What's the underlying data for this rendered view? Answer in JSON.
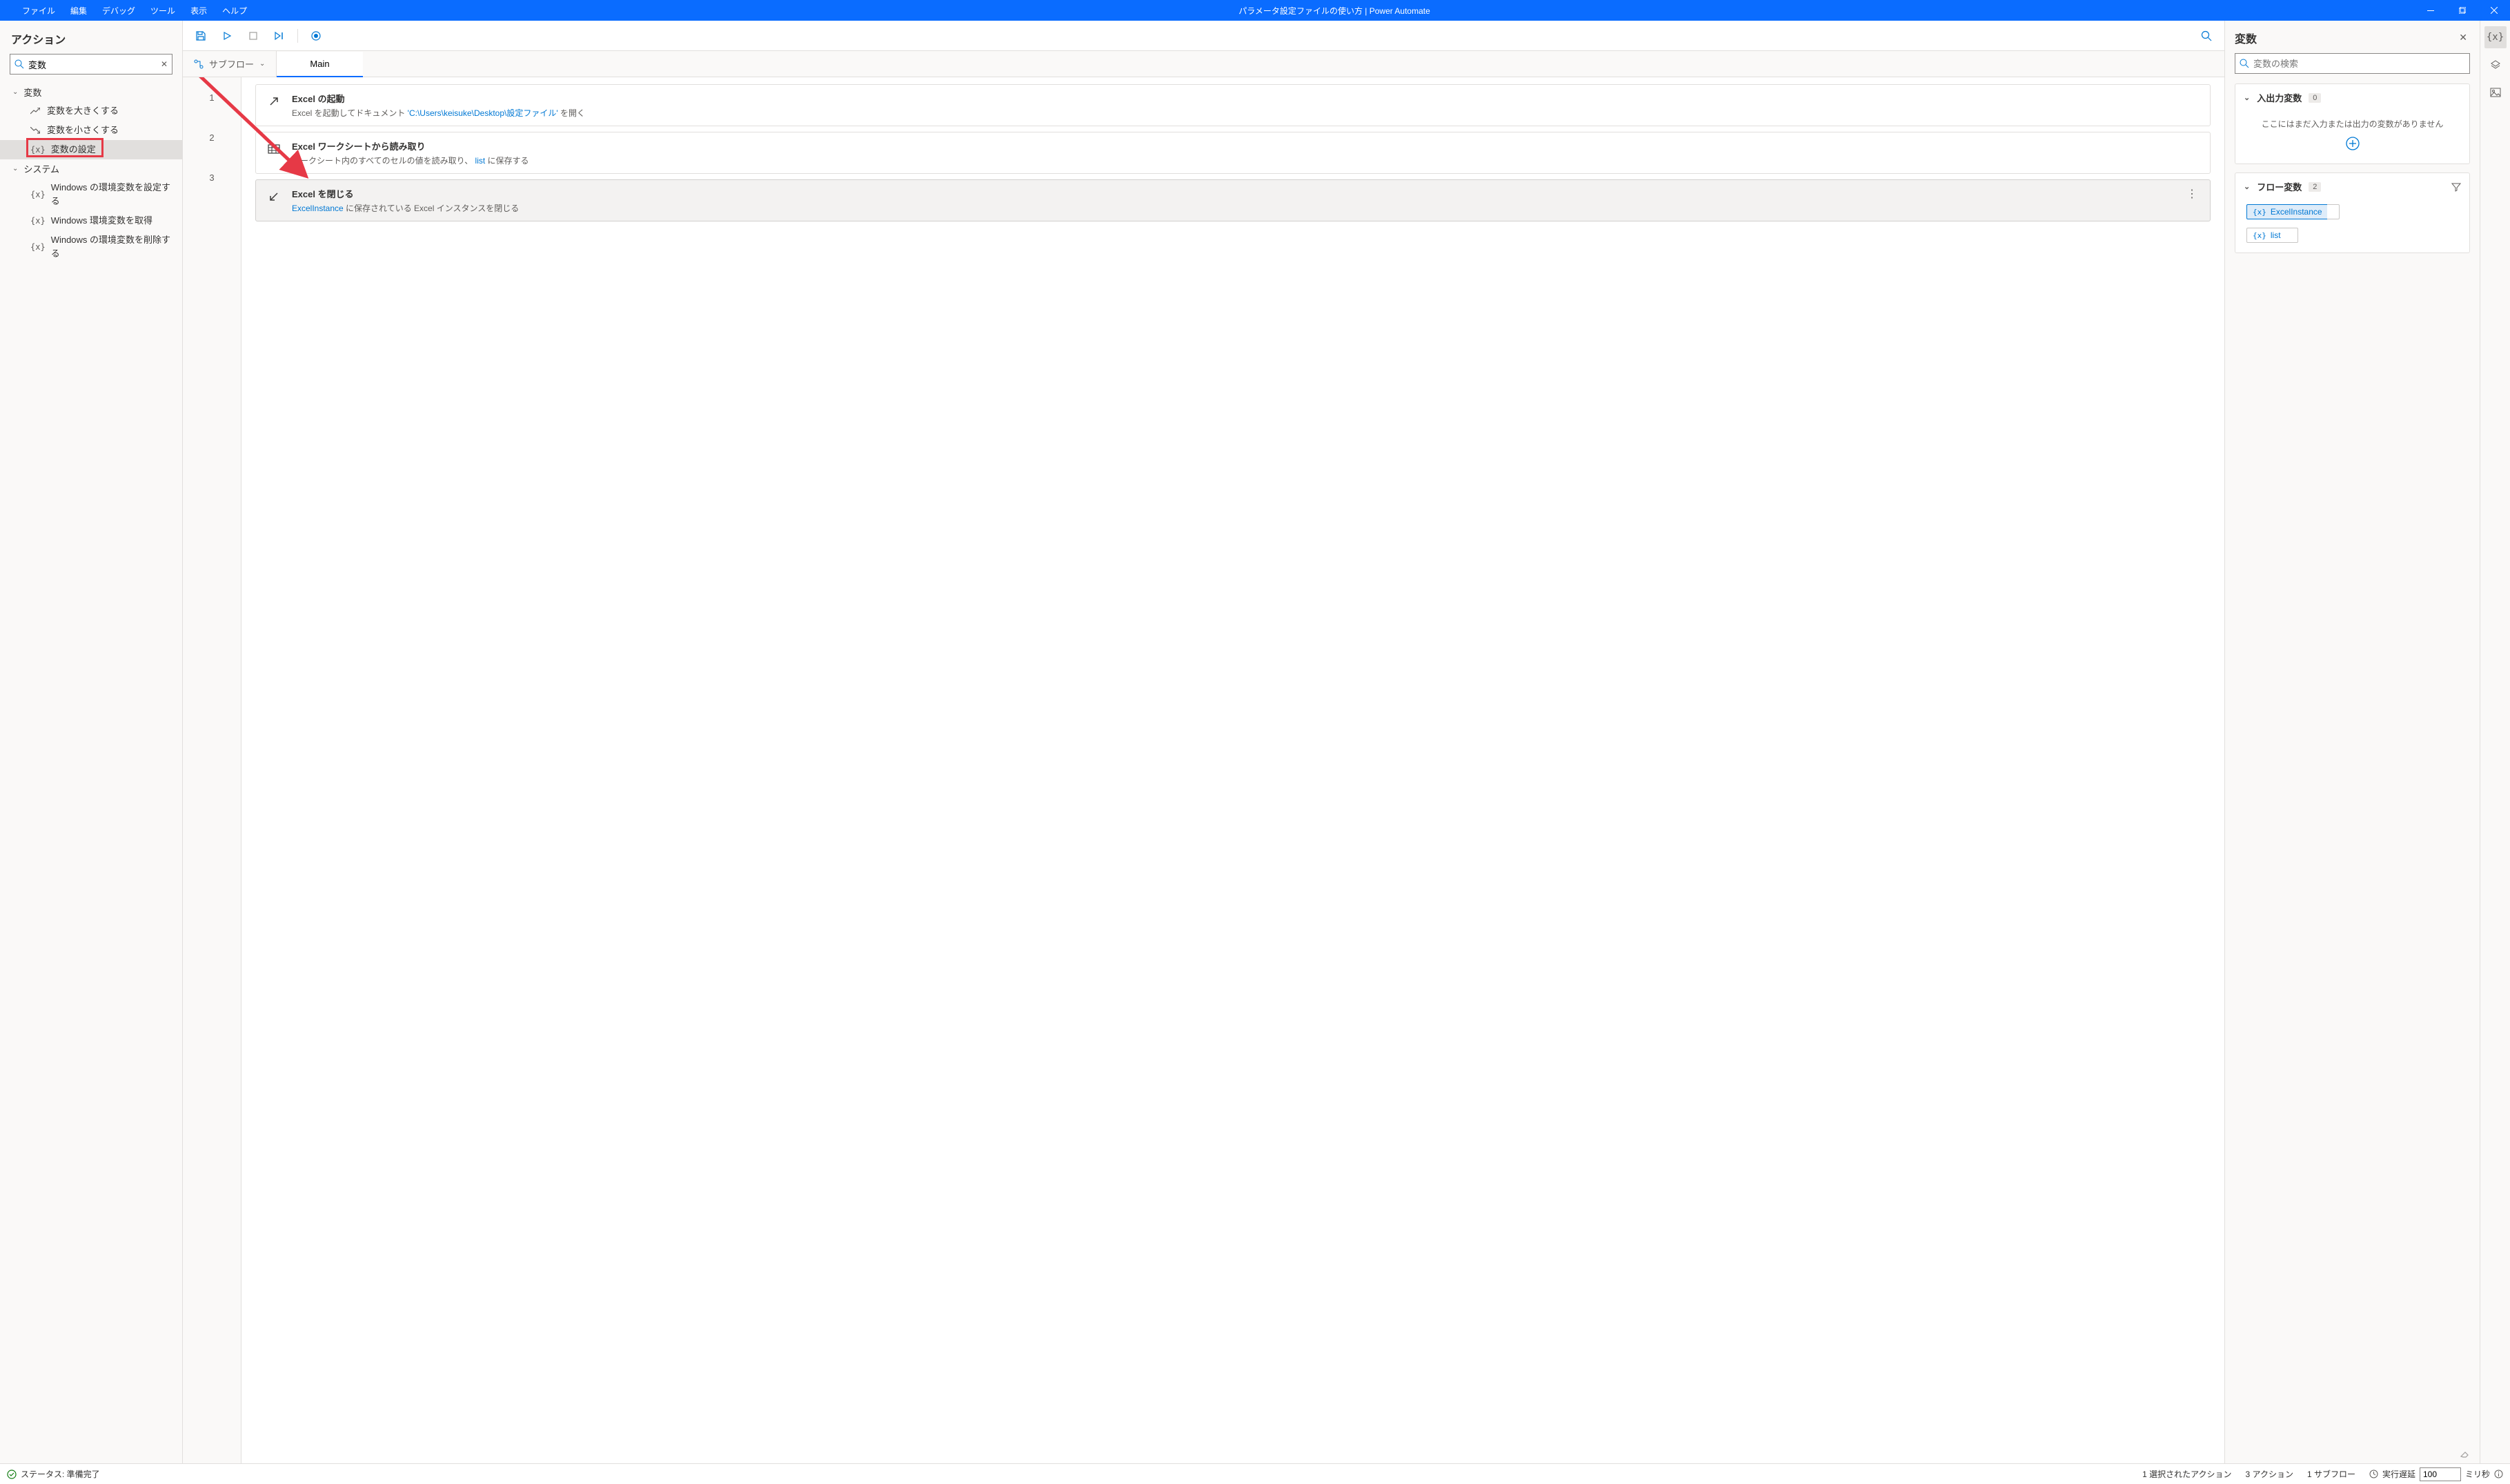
{
  "titlebar": {
    "menus": [
      "ファイル",
      "編集",
      "デバッグ",
      "ツール",
      "表示",
      "ヘルプ"
    ],
    "title": "パラメータ設定ファイルの使い方 | Power Automate"
  },
  "actions": {
    "title": "アクション",
    "search_value": "変数",
    "groups": [
      {
        "label": "変数",
        "items": [
          {
            "icon": "trend-up",
            "label": "変数を大きくする"
          },
          {
            "icon": "trend-down",
            "label": "変数を小さくする"
          },
          {
            "icon": "brace",
            "label": "変数の設定",
            "selected": true,
            "highlight": true
          }
        ]
      },
      {
        "label": "システム",
        "items": [
          {
            "icon": "brace",
            "label": "Windows の環境変数を設定する"
          },
          {
            "icon": "brace",
            "label": "Windows 環境変数を取得"
          },
          {
            "icon": "brace",
            "label": "Windows の環境変数を削除する"
          }
        ]
      }
    ]
  },
  "designer": {
    "subflow_label": "サブフロー",
    "main_tab": "Main",
    "steps": [
      {
        "num": "1",
        "icon": "arrow-ne",
        "title": "Excel の起動",
        "desc_pre": "Excel を起動してドキュメント ",
        "desc_link": "'C:\\Users\\keisuke\\Desktop\\設定ファイル'",
        "desc_post": " を開く"
      },
      {
        "num": "2",
        "icon": "grid",
        "title": "Excel ワークシートから読み取り",
        "desc_pre": "ワークシート内のすべてのセルの値を読み取り、 ",
        "desc_link": "list",
        "desc_post": "  に保存する"
      },
      {
        "num": "3",
        "icon": "arrow-sw",
        "title": "Excel を閉じる",
        "desc_pre": "",
        "desc_link": "ExcelInstance",
        "desc_post": "  に保存されている Excel インスタンスを閉じる",
        "selected": true
      }
    ]
  },
  "vars": {
    "title": "変数",
    "search_placeholder": "変数の検索",
    "io_section": {
      "label": "入出力変数",
      "count": "0",
      "empty_text": "ここにはまだ入力または出力の変数がありません"
    },
    "flow_section": {
      "label": "フロー変数",
      "count": "2",
      "items": [
        {
          "name": "ExcelInstance",
          "highlighted": true
        },
        {
          "name": "list"
        }
      ]
    }
  },
  "statusbar": {
    "status": "ステータス: 準備完了",
    "selected_actions": "1 選択されたアクション",
    "actions_count": "3 アクション",
    "subflows_count": "1 サブフロー",
    "delay_label": "実行遅延",
    "delay_value": "100",
    "delay_unit": "ミリ秒"
  }
}
